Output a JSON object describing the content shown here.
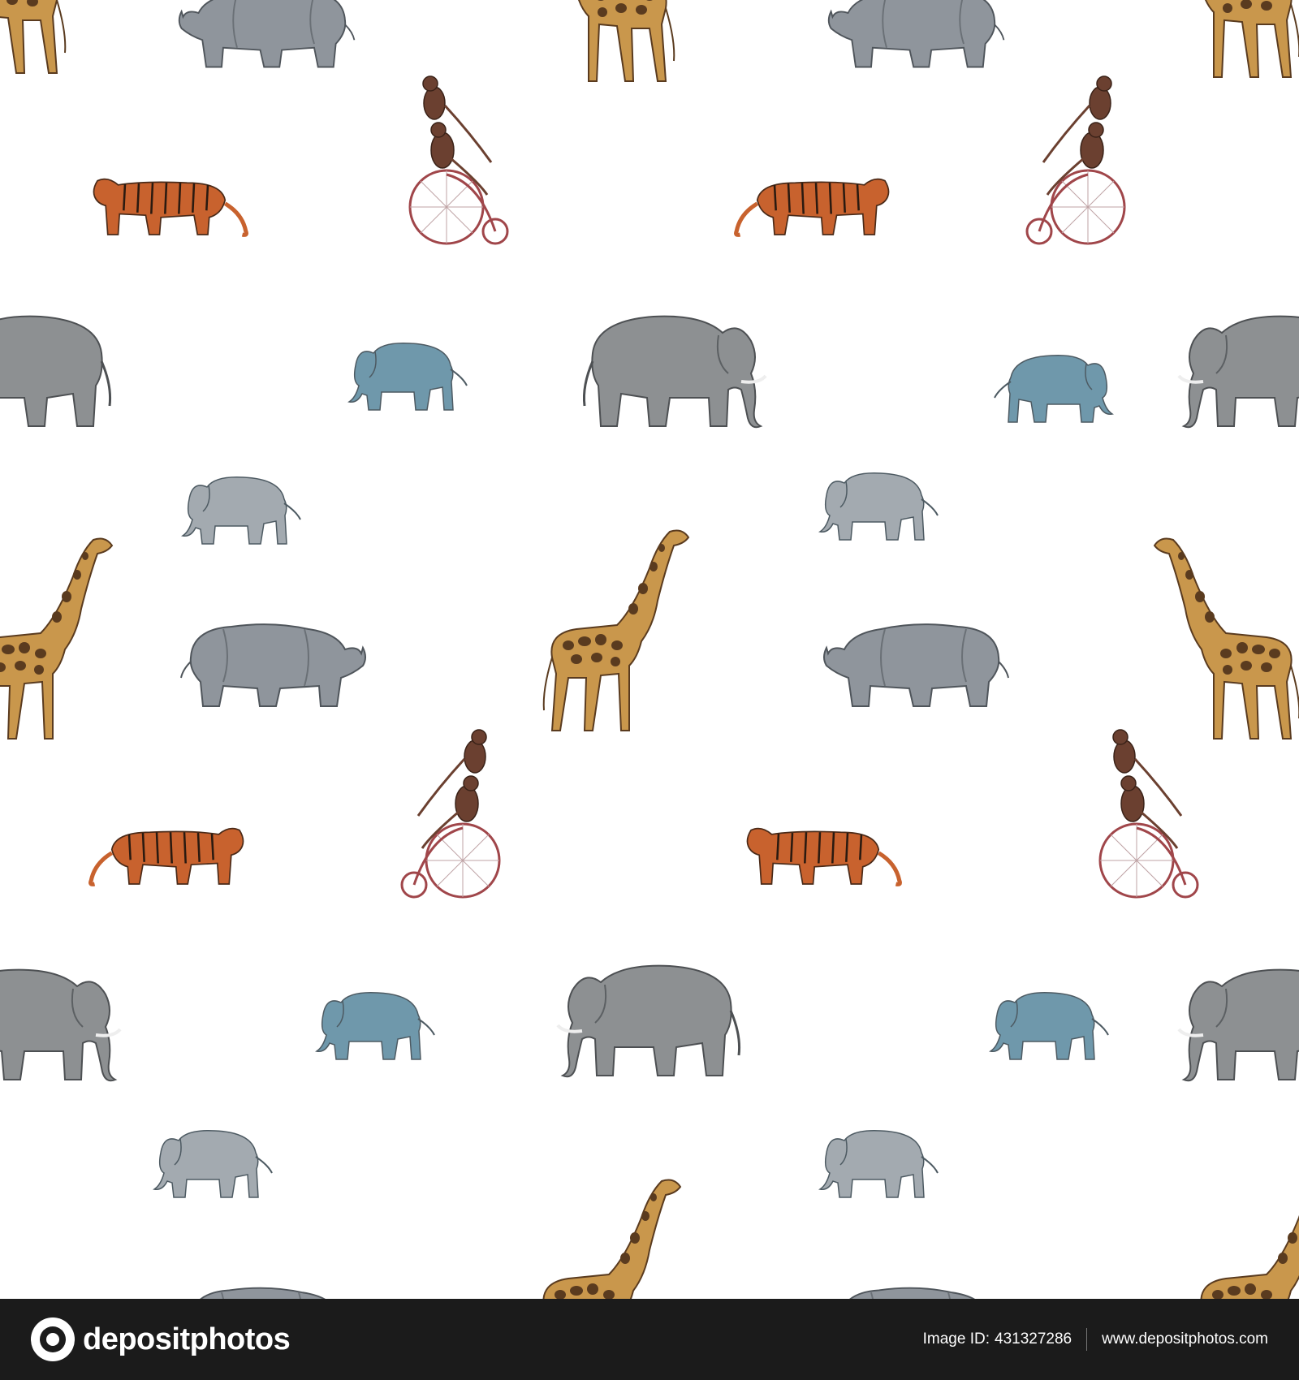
{
  "image": {
    "description_colors": {
      "background": "#ffffff",
      "elephant_gray": "#8d9092",
      "baby_elephant_blue": "#6f98ab",
      "baby_elephant_gray": "#a3aab0",
      "rhino_gray": "#8f959c",
      "tiger_orange": "#c8622e",
      "giraffe_tan": "#c9974c",
      "giraffe_spot": "#5a3b1f",
      "monkey_brown": "#6b4030",
      "bicycle_red": "#a0464a"
    }
  },
  "footer": {
    "brand": "depositphotos",
    "image_id_label": "Image ID:",
    "image_id": "431327286",
    "site": "www.depositphotos.com",
    "background": "#1b1b1b"
  }
}
